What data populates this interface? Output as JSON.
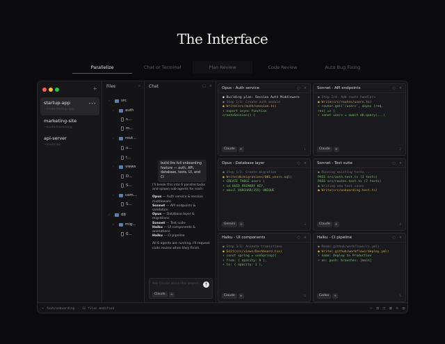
{
  "hero": {
    "title": "The Interface"
  },
  "tabs": [
    "Parallelize",
    "Chat or Terminal",
    "Plan Review",
    "Code Review",
    "Auto Bug Fixing"
  ],
  "colors": {
    "red": "#ff5f57",
    "yellow": "#febc2e",
    "green": "#28c840",
    "accent": "#5c7fb3"
  },
  "sidebar": {
    "projects": [
      {
        "name": "startup-app",
        "sub": "~/code/startup-app"
      },
      {
        "name": "marketing-site",
        "sub": "~/code/marketing"
      },
      {
        "name": "api-server",
        "sub": "~/code/api"
      }
    ]
  },
  "files": {
    "title": "Files",
    "tree": [
      {
        "label": "src",
        "type": "folder"
      },
      {
        "label": "auth",
        "type": "folder"
      },
      {
        "label": "s...",
        "type": "file"
      },
      {
        "label": "m...",
        "type": "file"
      },
      {
        "label": "rout...",
        "type": "folder"
      },
      {
        "label": "u...",
        "type": "file"
      },
      {
        "label": "t...",
        "type": "file"
      },
      {
        "label": "views",
        "type": "folder"
      },
      {
        "label": "D...",
        "type": "file"
      },
      {
        "label": "S...",
        "type": "file"
      },
      {
        "label": "com...",
        "type": "folder"
      },
      {
        "label": "S...",
        "type": "file"
      },
      {
        "label": "db",
        "type": "folder"
      },
      {
        "label": "mig...",
        "type": "folder"
      },
      {
        "label": "0...",
        "type": "file"
      }
    ]
  },
  "chat": {
    "title": "Chat",
    "user_message": "build the full onboarding feature — auth, API, database, tests, UI, and CI",
    "intro": "I'll break this into 6 parallel tasks and spawn sub-agents for each:",
    "assignments": [
      {
        "model": "Opus",
        "task": "— Auth service & session middleware"
      },
      {
        "model": "Sonnet",
        "task": "— API endpoints & validation"
      },
      {
        "model": "Opus",
        "task": "— Database layer & migrations"
      },
      {
        "model": "Sonnet",
        "task": "— Test suite"
      },
      {
        "model": "Haiku",
        "task": "— UI components & animations"
      },
      {
        "model": "Haiku",
        "task": "— CI pipeline"
      }
    ],
    "outro": "All 6 agents are running. I'll request code review when they finish.",
    "input_placeholder": "Ask Claude about this project...",
    "model": "Claude"
  },
  "agents": [
    {
      "title": "Opus - Auth service",
      "model": "Claude",
      "count": "1",
      "lines": [
        {
          "t": "● Building plan: Session Auth Middleware",
          "c": "l-white"
        },
        {
          "t": "● Step 1/3: Create auth module",
          "c": "l-step"
        },
        {
          "t": "● Write(src/auth/session.ts)",
          "c": "l-write"
        },
        {
          "t": "+ export async function",
          "c": "l-green"
        },
        {
          "t": "createSession() {",
          "c": "l-green"
        }
      ]
    },
    {
      "title": "Sonnet - API endpoints",
      "model": "Claude",
      "count": "2",
      "lines": [
        {
          "t": "● Step 2/4: Add route handlers",
          "c": "l-step"
        },
        {
          "t": "● Write(src/routes/users.ts)",
          "c": "l-write"
        },
        {
          "t": "+ router.get('/users', async (req,",
          "c": "l-green"
        },
        {
          "t": "res) => {",
          "c": "l-green"
        },
        {
          "t": "+ const users = await db.query(...)",
          "c": "l-green"
        }
      ]
    },
    {
      "title": "Opus - Database layer",
      "model": "Gemini",
      "count": "3",
      "lines": [
        {
          "t": "● Step 1/2: Create migration",
          "c": "l-step"
        },
        {
          "t": "● Write(db/migrations/001_users.sql)",
          "c": "l-write"
        },
        {
          "t": "+ CREATE TABLE users (",
          "c": "l-green"
        },
        {
          "t": "+ id UUID PRIMARY KEY,",
          "c": "l-green"
        },
        {
          "t": "+ email VARCHAR(255) UNIQUE",
          "c": "l-green"
        }
      ]
    },
    {
      "title": "Sonnet - Test suite",
      "model": "Claude",
      "count": "4",
      "lines": [
        {
          "t": "● Running existing tests...",
          "c": "l-step"
        },
        {
          "t": "PASS src/auth.test.ts (3 tests)",
          "c": "l-green"
        },
        {
          "t": "PASS src/routes.test.ts (7 tests)",
          "c": "l-green"
        },
        {
          "t": "● Writing new test cases",
          "c": "l-step"
        },
        {
          "t": "● Write(src/onboarding.test.ts)",
          "c": "l-write"
        }
      ]
    },
    {
      "title": "Haiku - UI components",
      "model": "Claude",
      "count": "5",
      "lines": [
        {
          "t": "● Step 3/3: Animate transitions",
          "c": "l-step"
        },
        {
          "t": "● Edit(src/views/Dashboard.tsx)",
          "c": "l-write"
        },
        {
          "t": "+ const spring = useSpring({",
          "c": "l-green"
        },
        {
          "t": "+ from: { opacity: 0 },",
          "c": "l-green"
        },
        {
          "t": "+ to: { opacity: 1 },",
          "c": "l-green"
        }
      ]
    },
    {
      "title": "Haiku - CI pipeline",
      "model": "Codex",
      "count": "6",
      "lines": [
        {
          "t": "● Read(.github/workflows/ci.yml)",
          "c": "l-step"
        },
        {
          "t": "● Write(.github/workflows/deploy.yml)",
          "c": "l-write"
        },
        {
          "t": "+ name: Deploy to Production",
          "c": "l-green"
        },
        {
          "t": "+ on: push: branches: [main]",
          "c": "l-green"
        }
      ]
    }
  ],
  "status": {
    "branch": "feat/onboarding",
    "changes": "12 files modified"
  }
}
